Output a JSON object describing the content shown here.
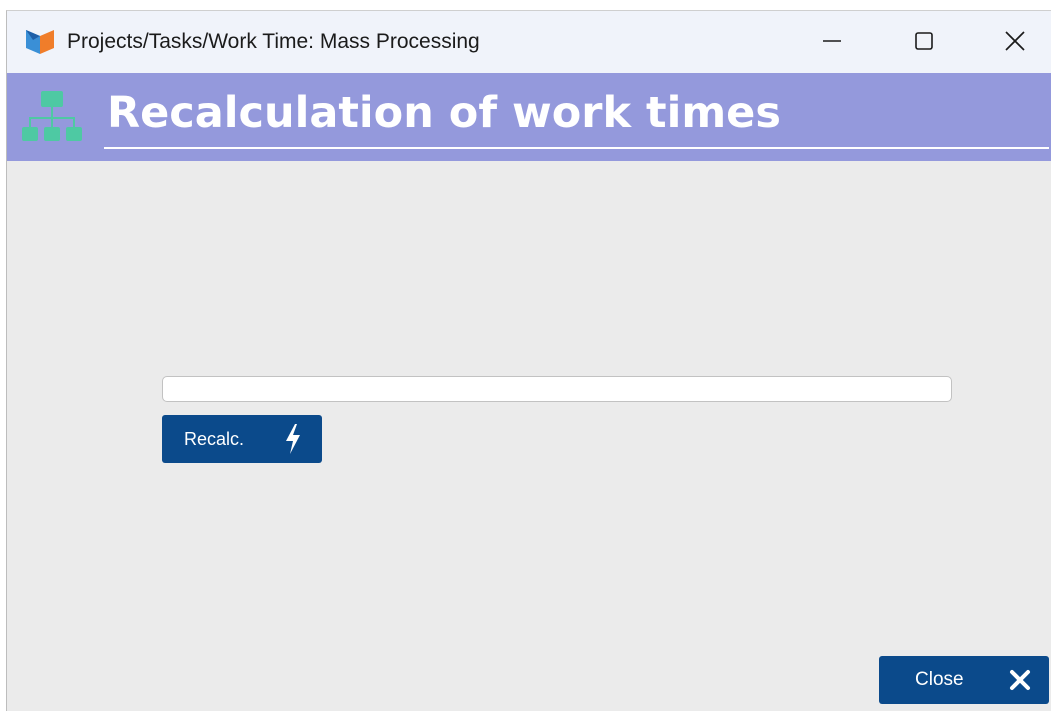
{
  "window": {
    "title": "Projects/Tasks/Work Time: Mass Processing",
    "app_icon": "app-logo-icon",
    "controls": {
      "minimize_icon": "minimize-icon",
      "maximize_icon": "maximize-icon",
      "close_icon": "close-icon"
    }
  },
  "banner": {
    "title": "Recalculation of work times",
    "icon": "hierarchy-icon",
    "background_color": "#9499dc"
  },
  "progress": {
    "value_percent": 0
  },
  "actions": {
    "recalc_label": "Recalc.",
    "recalc_icon": "lightning-icon",
    "close_label": "Close",
    "close_icon": "close-x-icon",
    "button_color": "#0b4a8b"
  }
}
